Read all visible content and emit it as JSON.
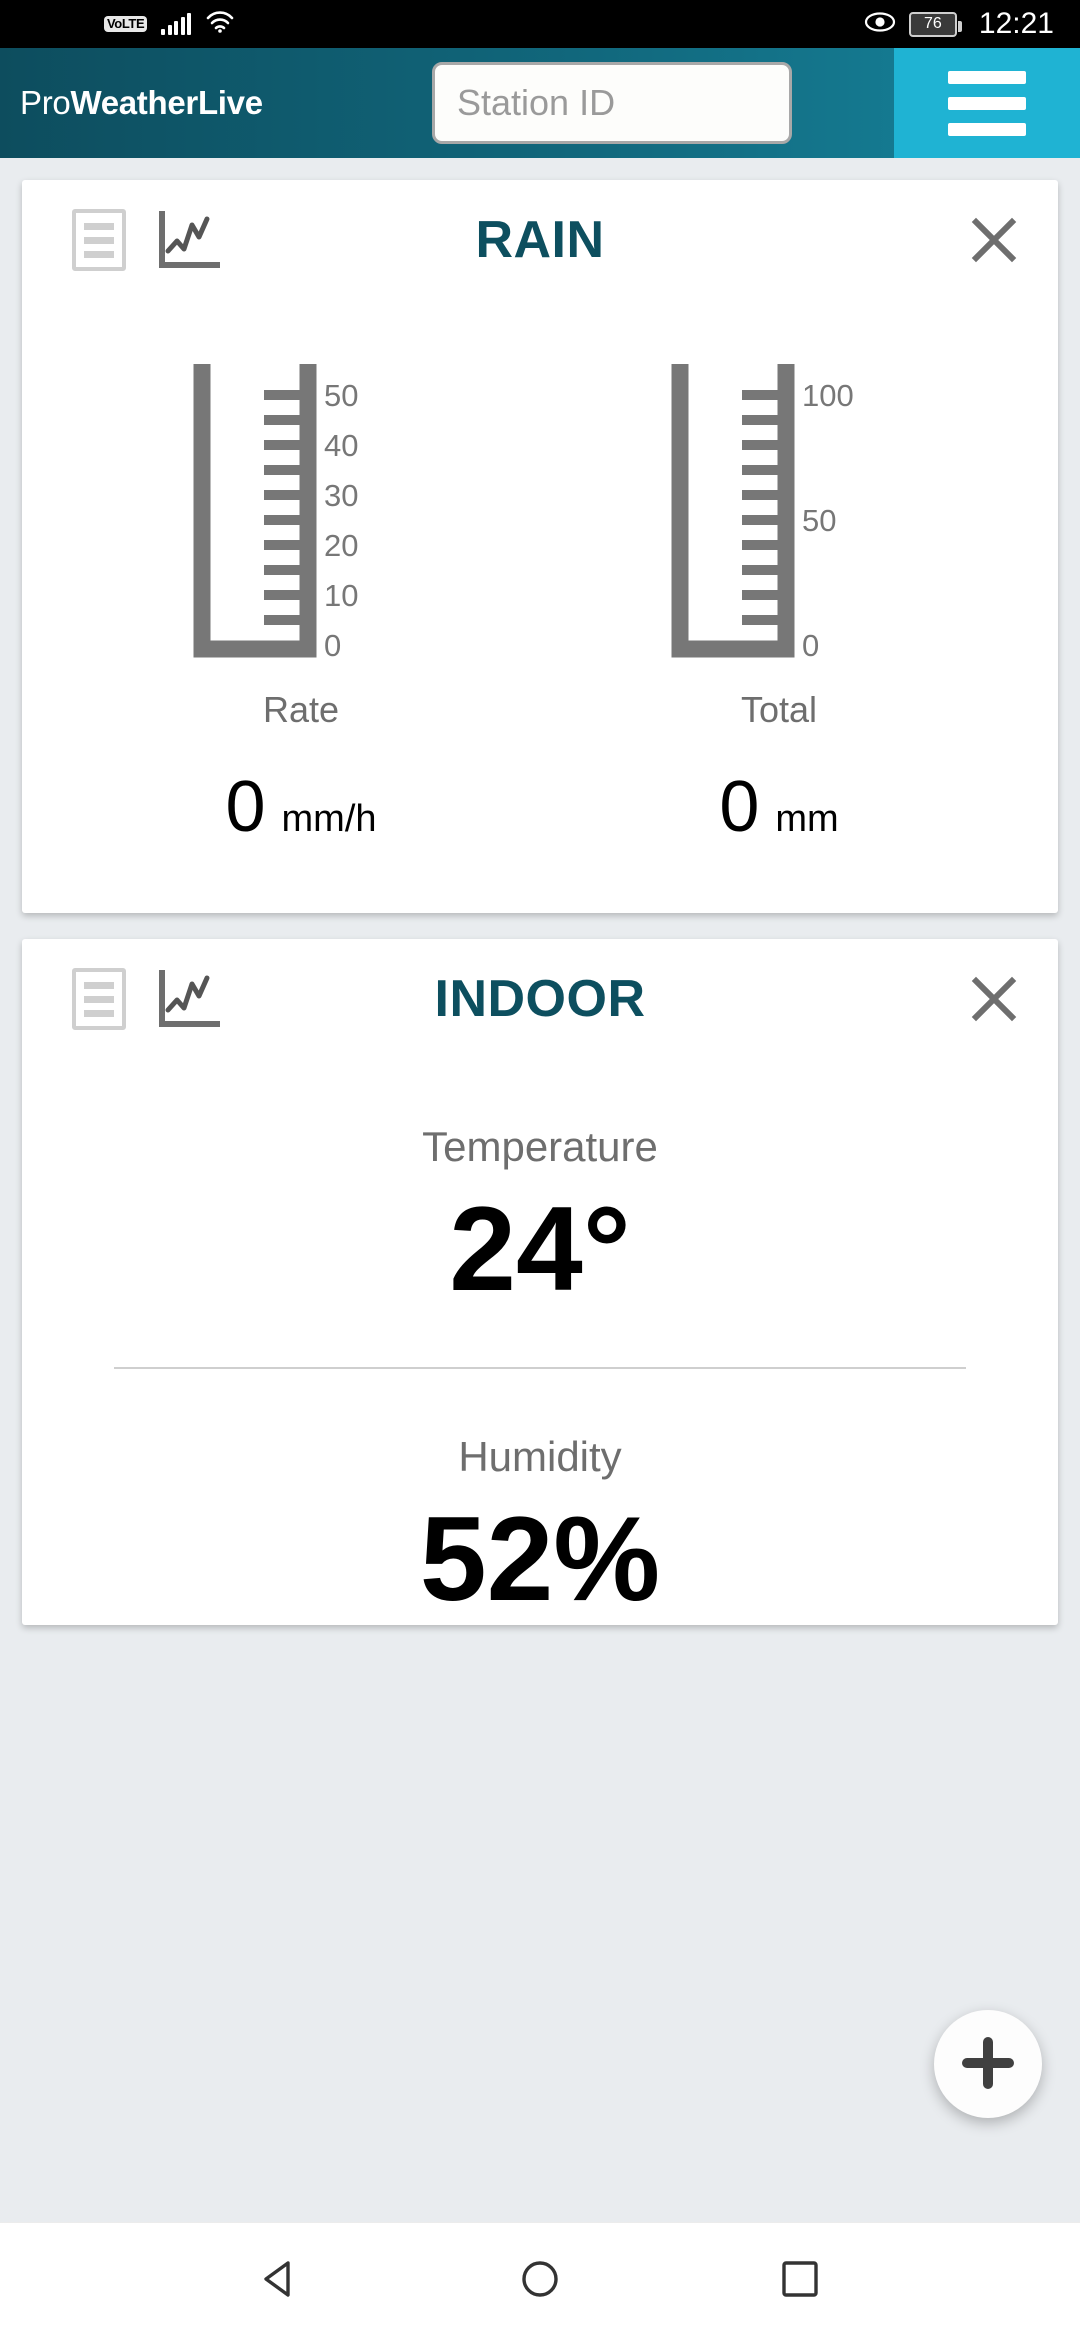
{
  "status_bar": {
    "volte_label": "VoLTE",
    "signal_icon": "signal-bars-icon",
    "wifi_icon": "wifi-icon",
    "eye_icon": "eye-icon",
    "battery_level": "76",
    "time": "12:21"
  },
  "header": {
    "logo_prefix": "Pro",
    "logo_bold": "WeatherLive",
    "station_placeholder": "Station ID",
    "station_value": "",
    "menu_icon": "hamburger-menu-icon",
    "accent_color": "#1fb3d3",
    "bar_color_start": "#0d4d5e",
    "bar_color_end": "#17849c"
  },
  "cards": [
    {
      "title": "RAIN",
      "list_icon": "list-view-icon",
      "chart_icon": "line-chart-icon",
      "close_icon": "close-icon",
      "title_color": "#0d4f5f",
      "gauges": [
        {
          "label": "Rate",
          "value": "0",
          "unit": "mm/h",
          "min": 0,
          "max": 50,
          "major_ticks": [
            "0",
            "10",
            "20",
            "30",
            "40",
            "50"
          ],
          "tick_count": 10,
          "fill": 0
        },
        {
          "label": "Total",
          "value": "0",
          "unit": "mm",
          "min": 0,
          "max": 100,
          "major_ticks": [
            "0",
            "50",
            "100"
          ],
          "tick_count": 10,
          "fill": 0
        }
      ]
    },
    {
      "title": "INDOOR",
      "list_icon": "list-view-icon",
      "chart_icon": "line-chart-icon",
      "close_icon": "close-icon",
      "title_color": "#0d4f5f",
      "metrics": [
        {
          "label": "Temperature",
          "value": "24°"
        },
        {
          "label": "Humidity",
          "value": "52%"
        }
      ]
    }
  ],
  "fab": {
    "icon": "plus-icon",
    "label": "+"
  },
  "nav_bar": {
    "back_icon": "back-triangle-icon",
    "home_icon": "home-circle-icon",
    "recents_icon": "recents-square-icon"
  },
  "chart_data": {
    "type": "bar",
    "title": "RAIN",
    "categories": [
      "Rate",
      "Total"
    ],
    "values": [
      0,
      0
    ],
    "units": [
      "mm/h",
      "mm"
    ],
    "ylim": [
      0,
      100
    ],
    "series": [
      {
        "name": "Rate",
        "value": 0,
        "unit": "mm/h",
        "axis_ticks": [
          0,
          10,
          20,
          30,
          40,
          50
        ],
        "axis_max": 50
      },
      {
        "name": "Total",
        "value": 0,
        "unit": "mm",
        "axis_ticks": [
          0,
          50,
          100
        ],
        "axis_max": 100
      }
    ],
    "grid": false,
    "legend": "none"
  }
}
